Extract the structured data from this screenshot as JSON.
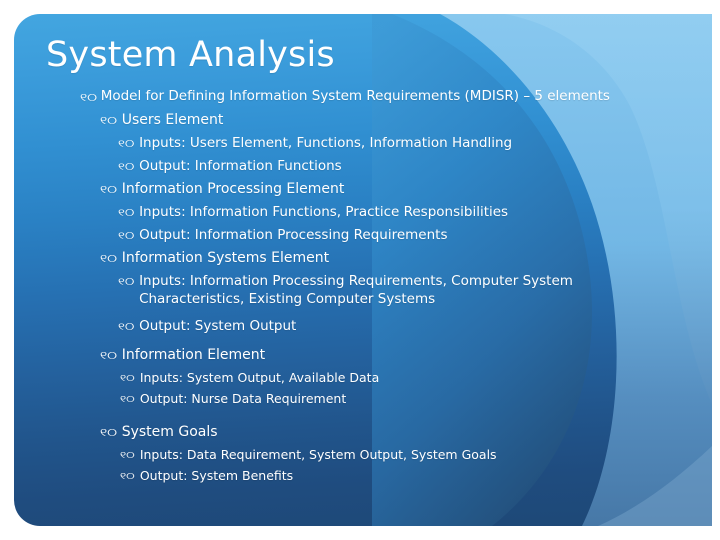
{
  "slide": {
    "title": "System Analysis",
    "bullet_glyph": "୧୦",
    "bullet_glyph_name": "wingdings-knot-bullet",
    "colors": {
      "background_page": "#ffffff",
      "slide_top": "#43a6e0",
      "slide_mid": "#2a81c4",
      "slide_bottom": "#1e4876",
      "swoosh_light": "#7fc2ea",
      "swoosh_lighter": "#8fcaee",
      "swoosh_dark": "#2b7dbd",
      "text": "#ffffff"
    },
    "items": [
      {
        "level": 1,
        "text": "Model for Defining Information System Requirements (MDISR) – 5 elements"
      },
      {
        "level": 2,
        "text": "Users Element"
      },
      {
        "level": 3,
        "text": "Inputs: Users Element, Functions, Information Handling"
      },
      {
        "level": 3,
        "text": "Output: Information Functions"
      },
      {
        "level": 2,
        "text": "Information Processing Element"
      },
      {
        "level": 3,
        "text": "Inputs: Information Functions, Practice Responsibilities"
      },
      {
        "level": 3,
        "text": "Output: Information Processing Requirements"
      },
      {
        "level": 2,
        "text": "Information Systems Element"
      },
      {
        "level": 3,
        "text": "Inputs: Information Processing Requirements, Computer System Characteristics, Existing Computer Systems"
      },
      {
        "level": 3,
        "text": "Output: System Output"
      },
      {
        "level": 2,
        "text": "Information Element"
      },
      {
        "level": 3,
        "size": "small",
        "text": "Inputs: System Output, Available Data"
      },
      {
        "level": 3,
        "size": "small",
        "text": "Output: Nurse Data Requirement"
      },
      {
        "level": 2,
        "text": "System Goals"
      },
      {
        "level": 3,
        "size": "small",
        "text": "Inputs: Data Requirement, System Output, System Goals"
      },
      {
        "level": 3,
        "size": "small",
        "text": "Output: System Benefits"
      }
    ]
  }
}
